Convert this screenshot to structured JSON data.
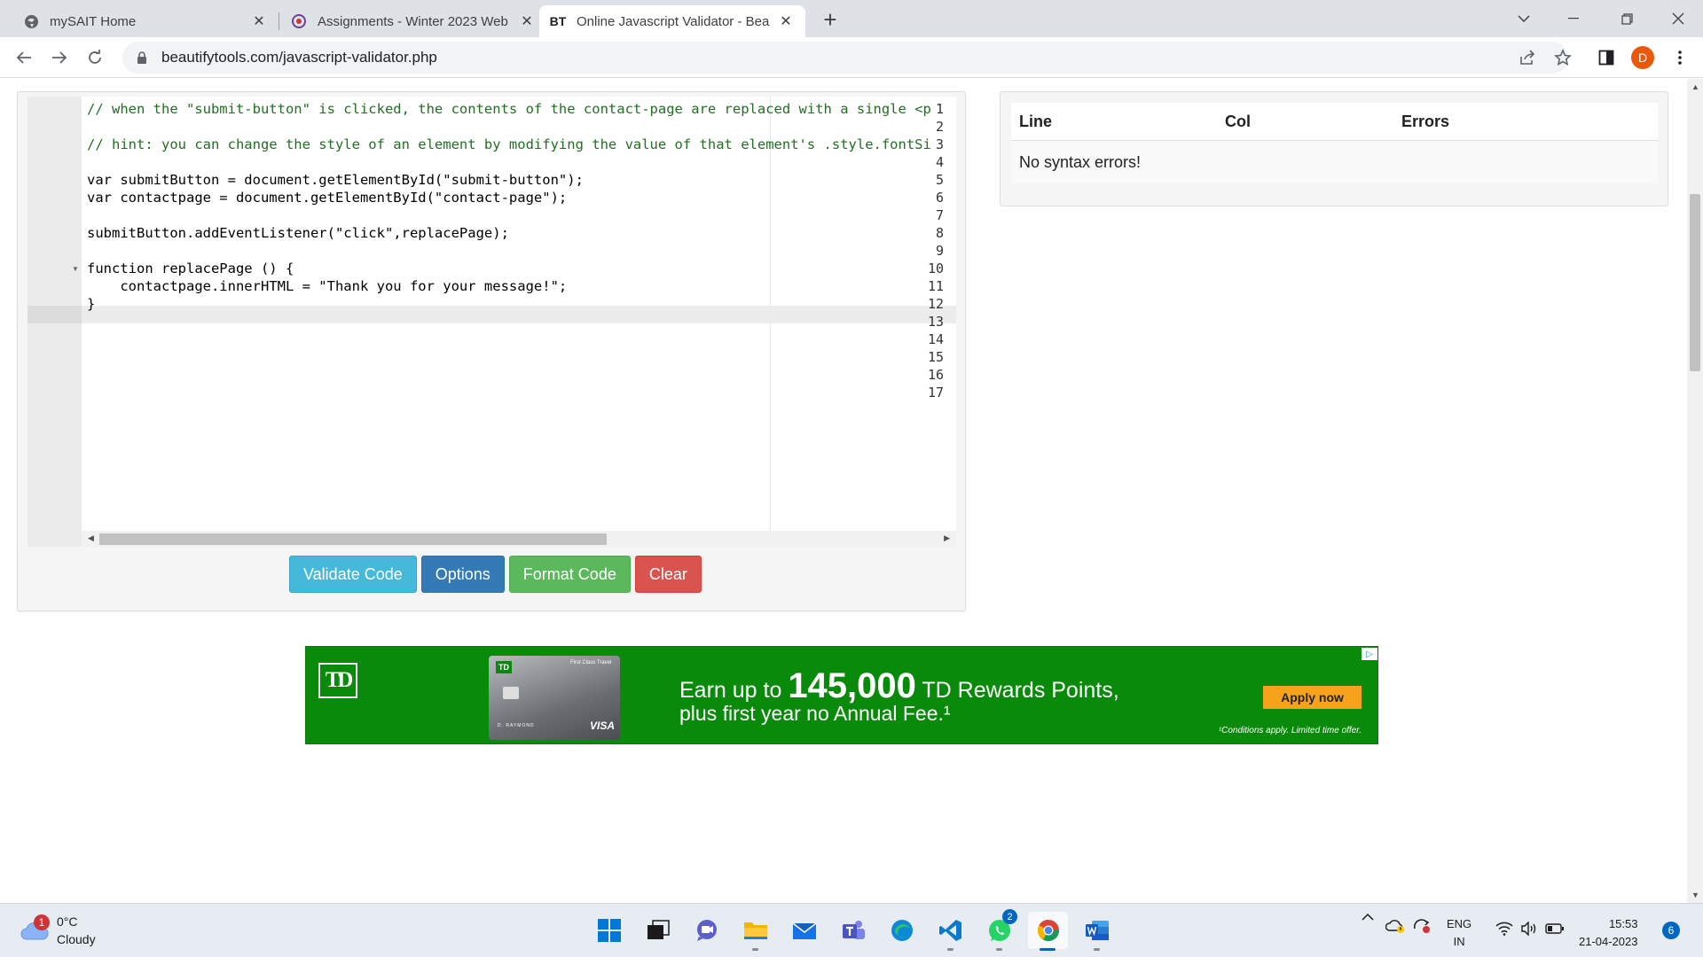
{
  "browser": {
    "tabs": [
      {
        "title": "mySAIT Home",
        "icon": "globe-icon"
      },
      {
        "title": "Assignments - Winter 2023 Web",
        "icon": "d2l-icon"
      },
      {
        "title": "Online Javascript Validator - Beau",
        "icon": "bt-logo-icon",
        "favicon_text": "BT"
      }
    ],
    "url": "beautifytools.com/javascript-validator.php",
    "profile_initial": "D"
  },
  "editor": {
    "line_numbers": [
      "1",
      "2",
      "3",
      "4",
      "5",
      "6",
      "7",
      "8",
      "9",
      "10",
      "11",
      "12",
      "13",
      "14",
      "15",
      "16",
      "17"
    ],
    "lines": [
      "// when the \"submit-button\" is clicked, the contents of the contact-page are replaced with a single <p",
      "",
      "// hint: you can change the style of an element by modifying the value of that element's .style.fontSi",
      "",
      "var submitButton = document.getElementById(\"submit-button\");",
      "var contactpage = document.getElementById(\"contact-page\");",
      "",
      "submitButton.addEventListener(\"click\",replacePage);",
      "",
      "function replacePage () {",
      "    contactpage.innerHTML = \"Thank you for your message!\";",
      "}"
    ],
    "active_line": 12
  },
  "buttons": {
    "validate": "Validate Code",
    "options": "Options",
    "format": "Format Code",
    "clear": "Clear"
  },
  "results": {
    "headers": [
      "Line",
      "Col",
      "Errors"
    ],
    "message": "No syntax errors!"
  },
  "ad": {
    "logo": "TD",
    "line1_prefix": "Earn up to ",
    "line1_number": "145,000",
    "line1_suffix": " TD Rewards Points,",
    "line2": "plus first year no Annual Fee.¹",
    "cta": "Apply now",
    "conditions": "¹Conditions apply. Limited time offer.",
    "card_title": "First Class Travel",
    "card_name": "D. RAYMOND",
    "card_brand": "VISA",
    "colors": {
      "background": "#0a8a0a",
      "cta": "#f7a21b"
    }
  },
  "taskbar": {
    "weather_temp": "0°C",
    "weather_desc": "Cloudy",
    "weather_badge": "1",
    "whatsapp_badge": "2",
    "lang_top": "ENG",
    "lang_bottom": "IN",
    "time": "15:53",
    "date": "21-04-2023",
    "notifications": "6"
  }
}
